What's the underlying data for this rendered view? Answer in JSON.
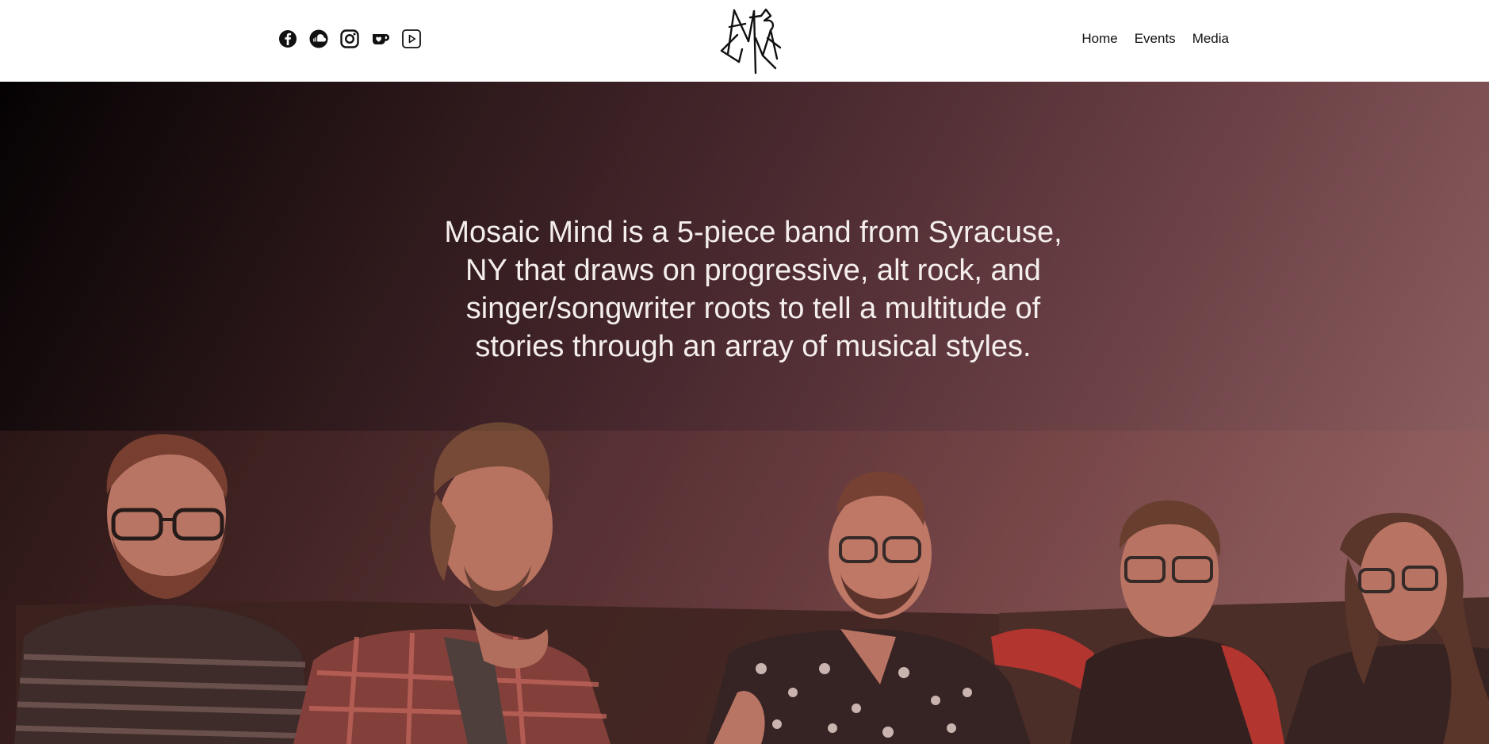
{
  "header": {
    "social_links": [
      {
        "icon": "facebook-icon"
      },
      {
        "icon": "soundcloud-icon"
      },
      {
        "icon": "instagram-icon"
      },
      {
        "icon": "ko-fi-icon"
      },
      {
        "icon": "youtube-icon"
      }
    ],
    "logo_icon": "mosaic-mind-logo",
    "nav": {
      "home": "Home",
      "events": "Events",
      "media": "Media"
    }
  },
  "hero": {
    "tagline": "Mosaic Mind is a 5-piece band from Syracuse, NY that draws on progressive, alt rock, and singer/songwriter roots to tell a multitude of stories through an array of musical styles.",
    "band_photo": "band-photo",
    "colors": {
      "gradient_dark": "#050203",
      "gradient_mid": "#4c2b31",
      "gradient_light": "#96686a",
      "text": "#f4eeec"
    }
  }
}
